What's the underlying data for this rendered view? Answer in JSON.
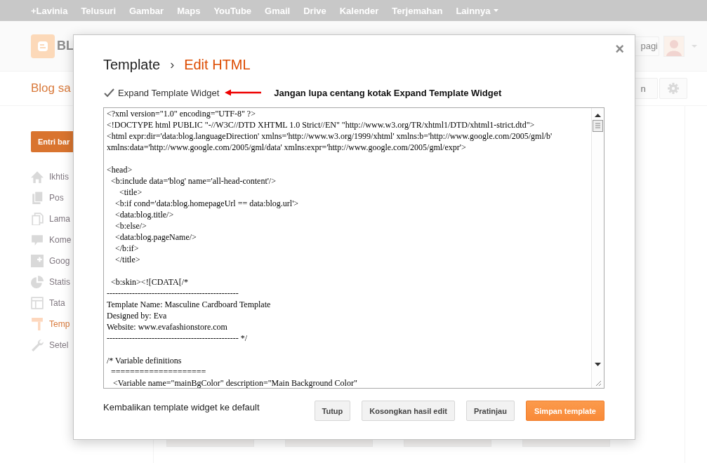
{
  "top_bar": {
    "links": [
      "+Lavinia",
      "Telusuri",
      "Gambar",
      "Maps",
      "YouTube",
      "Gmail",
      "Drive",
      "Kalender",
      "Terjemahan"
    ],
    "menu_label": "Lainnya"
  },
  "header": {
    "logo_text": "BL",
    "greeting_button": "pagi"
  },
  "blog_bar": {
    "title": "Blog sa",
    "button_label": "n"
  },
  "sidebar": {
    "new_post_button": "Entri bar",
    "items": [
      {
        "label": "Ikhtis",
        "selected": false
      },
      {
        "label": "Pos",
        "selected": false
      },
      {
        "label": "Lama",
        "selected": false
      },
      {
        "label": "Kome",
        "selected": false
      },
      {
        "label": "Goog",
        "selected": false
      },
      {
        "label": "Statis",
        "selected": false
      },
      {
        "label": "Tata",
        "selected": false
      },
      {
        "label": "Temp",
        "selected": true
      },
      {
        "label": "Setel",
        "selected": false
      }
    ]
  },
  "dialog": {
    "breadcrumb": "Template",
    "separator": "›",
    "title": "Edit HTML",
    "close": "×",
    "checkbox": {
      "label": "Expand Template Widget",
      "checked": true
    },
    "annotation": "Jangan lupa centang kotak Expand Template Widget",
    "code_blocks": [
      [
        "<?xml version=\"1.0\" encoding=\"UTF-8\" ?>",
        "<!DOCTYPE html PUBLIC \"-//W3C//DTD XHTML 1.0 Strict//EN\" \"http://www.w3.org/TR/xhtml1/DTD/xhtml1-strict.dtd\">",
        "<html expr:dir='data:blog.languageDirection' xmlns='http://www.w3.org/1999/xhtml' xmlns:b='http://www.google.com/2005/gml/b'",
        "xmlns:data='http://www.google.com/2005/gml/data' xmlns:expr='http://www.google.com/2005/gml/expr'>"
      ],
      [
        "<head>",
        "  <b:include data='blog' name='all-head-content'/>",
        "      <title>",
        "    <b:if cond='data:blog.homepageUrl == data:blog.url'>",
        "    <data:blog.title/>",
        "    <b:else/>",
        "    <data:blog.pageName/>",
        "    </b:if>",
        "    </title>"
      ],
      [
        "  <b:skin><![CDATA[/*",
        "-----------------------------------------------",
        "Template Name: Masculine Cardboard Template",
        "Designed by: Eva",
        "Website: www.evafashionstore.com",
        "----------------------------------------------- */"
      ],
      [
        "/* Variable definitions",
        "  ====================",
        "   <Variable name=\"mainBgColor\" description=\"Main Background Color\""
      ]
    ],
    "reset_link": "Kembalikan template widget ke default",
    "buttons": [
      {
        "label": "Tutup",
        "kind": "default"
      },
      {
        "label": "Kosongkan hasil edit",
        "kind": "default"
      },
      {
        "label": "Pratinjau",
        "kind": "default"
      },
      {
        "label": "Simpan template",
        "kind": "primary"
      }
    ]
  }
}
